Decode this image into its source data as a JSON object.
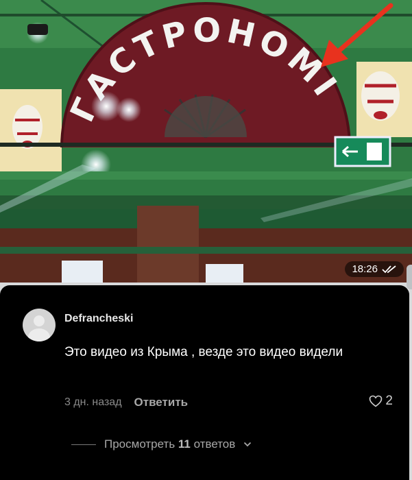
{
  "message": {
    "time": "18:26",
    "status_icon": "double-check-icon",
    "photo_sign_text": "ГАСТРОНОМІЯ"
  },
  "comment": {
    "username": "Defrancheski",
    "text": "Это видео из Крыма , везде это видео видели",
    "time_ago": "3 дн. назад",
    "reply_label": "Ответить",
    "likes": "2",
    "view_replies_prefix": "Просмотреть ",
    "view_replies_count": "11",
    "view_replies_suffix": " ответов"
  },
  "colors": {
    "wall_green": "#2f7a3f",
    "fan_red": "#6e1a24",
    "arrow_red": "#e8321e",
    "card_bg": "#000000",
    "muted_text": "#8a8a8a"
  }
}
